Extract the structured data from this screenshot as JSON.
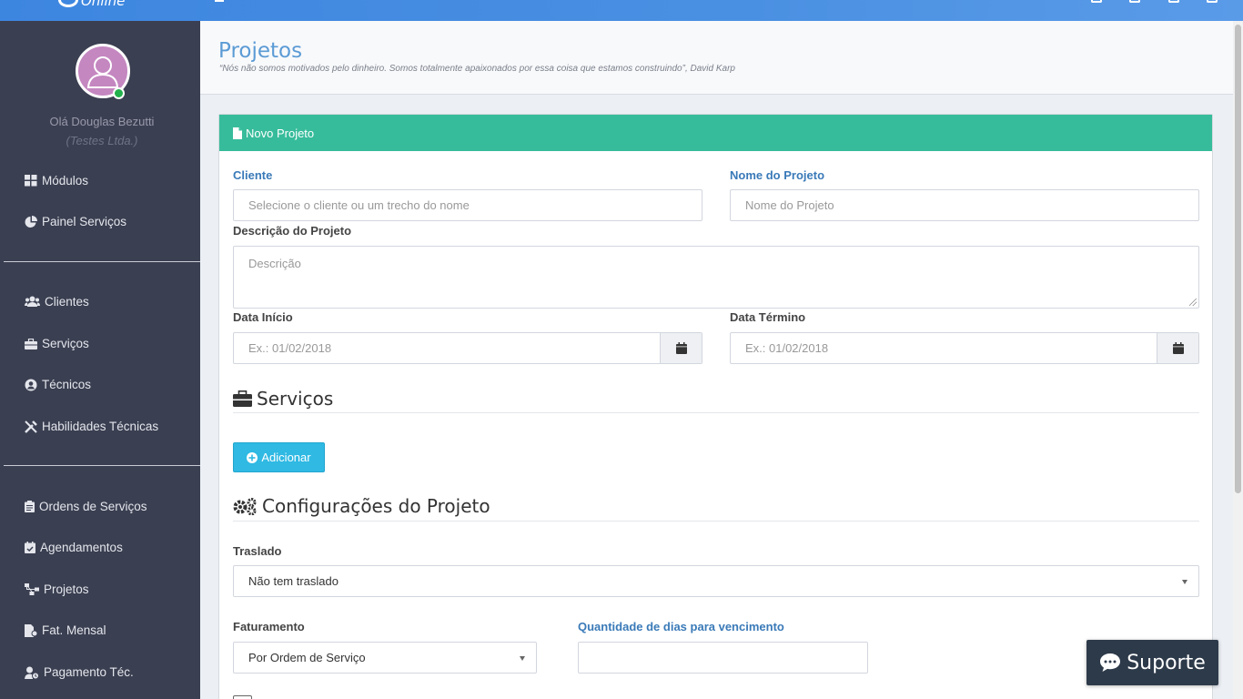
{
  "brand": {
    "name": "Online"
  },
  "sidebar": {
    "greeting": "Olá Douglas Bezutti",
    "company": "(Testes Ltda.)",
    "items": [
      {
        "label": "Módulos",
        "icon": "th-large-icon"
      },
      {
        "label": "Painel Serviços",
        "icon": "pie-chart-icon"
      },
      {
        "label": "Clientes",
        "icon": "users-icon"
      },
      {
        "label": "Serviços",
        "icon": "briefcase-icon"
      },
      {
        "label": "Técnicos",
        "icon": "user-circle-icon"
      },
      {
        "label": "Habilidades Técnicas",
        "icon": "tools-icon"
      },
      {
        "label": "Ordens de Serviços",
        "icon": "clipboard-icon"
      },
      {
        "label": "Agendamentos",
        "icon": "calendar-check-icon"
      },
      {
        "label": "Projetos",
        "icon": "sitemap-icon"
      },
      {
        "label": "Fat. Mensal",
        "icon": "file-invoice-icon"
      },
      {
        "label": "Pagamento Téc.",
        "icon": "user-clock-icon"
      }
    ]
  },
  "page": {
    "title": "Projetos",
    "quote": "“Nós não somos motivados pelo dinheiro. Somos totalmente apaixonados por essa coisa que estamos construindo”, David Karp"
  },
  "form": {
    "panel_title": "Novo Projeto",
    "cliente_label": "Cliente",
    "cliente_placeholder": "Selecione o cliente ou um trecho do nome",
    "nome_label": "Nome do Projeto",
    "nome_placeholder": "Nome do Projeto",
    "descricao_label": "Descrição do Projeto",
    "descricao_placeholder": "Descrição",
    "data_inicio_label": "Data Início",
    "data_inicio_placeholder": "Ex.: 01/02/2018",
    "data_termino_label": "Data Término",
    "data_termino_placeholder": "Ex.: 01/02/2018",
    "servicos_title": "Serviços",
    "add_button": "Adicionar",
    "config_title": "Configurações do Projeto",
    "traslado_label": "Traslado",
    "traslado_value": "Não tem traslado",
    "faturamento_label": "Faturamento",
    "faturamento_value": "Por Ordem de Serviço",
    "dias_label": "Quantidade de dias para vencimento",
    "dias_value": ""
  },
  "support": {
    "label": "Suporte"
  },
  "colors": {
    "topbar": "#4a90e2",
    "sidebar": "#3a3f51",
    "panel_header": "#37bc9b",
    "primary_button": "#2fb9e3",
    "support_button": "#2d3a4a"
  }
}
